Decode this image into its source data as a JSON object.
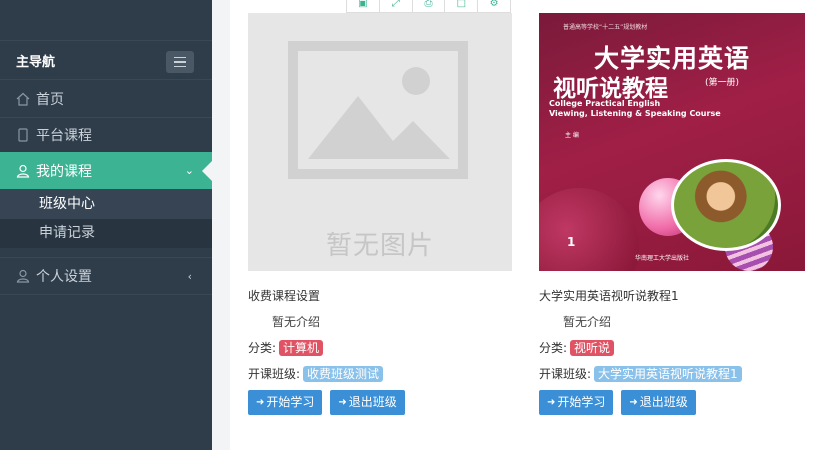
{
  "sidebar": {
    "title": "主导航",
    "items": [
      {
        "label": "首页",
        "icon": "home-icon"
      },
      {
        "label": "平台课程",
        "icon": "tablet-icon"
      },
      {
        "label": "我的课程",
        "icon": "user-icon",
        "active": true
      },
      {
        "label": "个人设置",
        "icon": "user-icon"
      }
    ],
    "submenu": [
      "班级中心",
      "申请记录"
    ]
  },
  "toolbar": {
    "icons": [
      "save-icon",
      "expand-icon",
      "print-icon",
      "window-icon",
      "gear-icon"
    ]
  },
  "courses": [
    {
      "image_placeholder": "暂无图片",
      "name": "收费课程设置",
      "intro": "暂无介绍",
      "category_label": "分类:",
      "category": "计算机",
      "class_label": "开课班级:",
      "class": "收费班级测试",
      "start_btn": "开始学习",
      "quit_btn": "退出班级"
    },
    {
      "cover": {
        "tagline": "普通高等学校“十二五”规划教材",
        "title_line1": "大学实用英语",
        "title_line2": "视听说教程",
        "volume": "(第一册)",
        "english_line1": "College Practical English",
        "english_line2": "Viewing, Listening & Speaking Course",
        "authors": "主 编",
        "number": "1",
        "publisher": "华南理工大学出版社"
      },
      "name": "大学实用英语视听说教程1",
      "intro": "暂无介绍",
      "category_label": "分类:",
      "category": "视听说",
      "class_label": "开课班级:",
      "class": "大学实用英语视听说教程1",
      "start_btn": "开始学习",
      "quit_btn": "退出班级"
    }
  ],
  "colors": {
    "sidebar_bg": "#2f3d4b",
    "active_green": "#3cb393",
    "button_blue": "#3a8fd6",
    "tag_red": "#e05364",
    "tag_blue": "#89c1ea"
  }
}
